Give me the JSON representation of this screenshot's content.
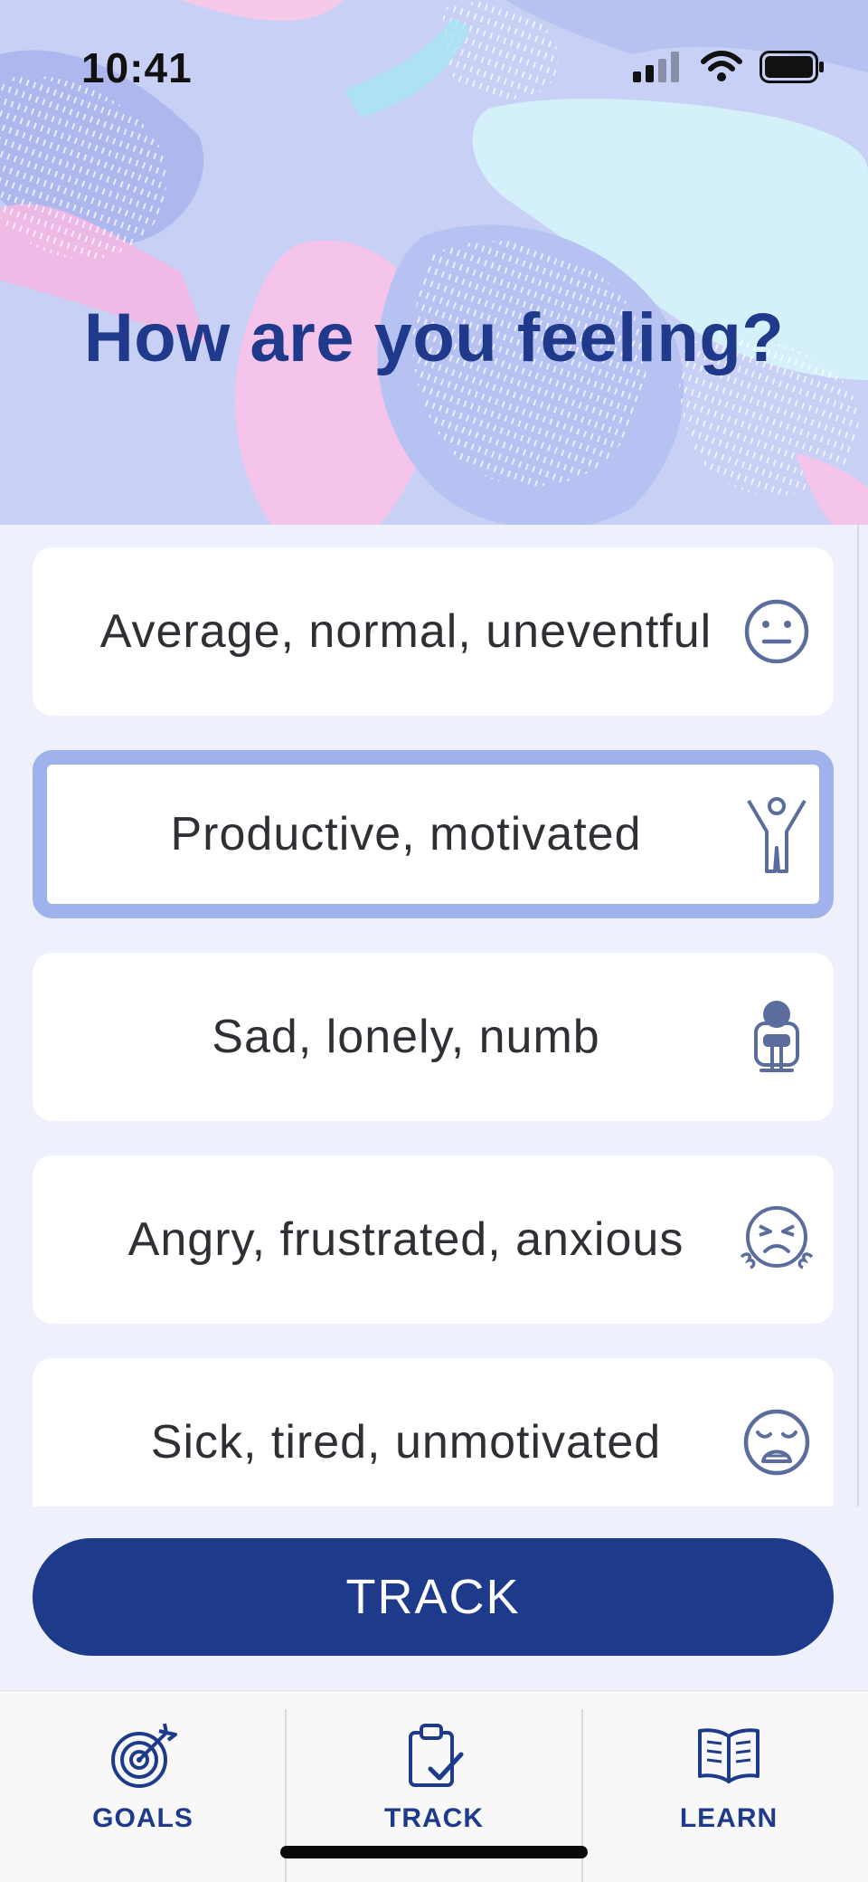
{
  "status": {
    "time": "10:41"
  },
  "header": {
    "title": "How are you feeling?"
  },
  "options": [
    {
      "label": "Average, normal, uneventful",
      "icon": "neutral-face-icon",
      "selected": false
    },
    {
      "label": "Productive, motivated",
      "icon": "person-arms-raised-icon",
      "selected": true
    },
    {
      "label": "Sad, lonely, numb",
      "icon": "person-hugging-knees-icon",
      "selected": false
    },
    {
      "label": "Angry, frustrated, anxious",
      "icon": "angry-face-icon",
      "selected": false
    },
    {
      "label": "Sick, tired, unmotivated",
      "icon": "tired-face-icon",
      "selected": false
    }
  ],
  "actions": {
    "track_label": "TRACK"
  },
  "tabbar": {
    "tabs": [
      {
        "label": "GOALS",
        "icon": "target-icon"
      },
      {
        "label": "TRACK",
        "icon": "clipboard-check-icon"
      },
      {
        "label": "LEARN",
        "icon": "book-icon"
      }
    ]
  },
  "colors": {
    "primary": "#1e3a8a",
    "selected_border": "#9fb2ec",
    "background": "#eef1fb",
    "icon_stroke": "#5b6d9c"
  }
}
